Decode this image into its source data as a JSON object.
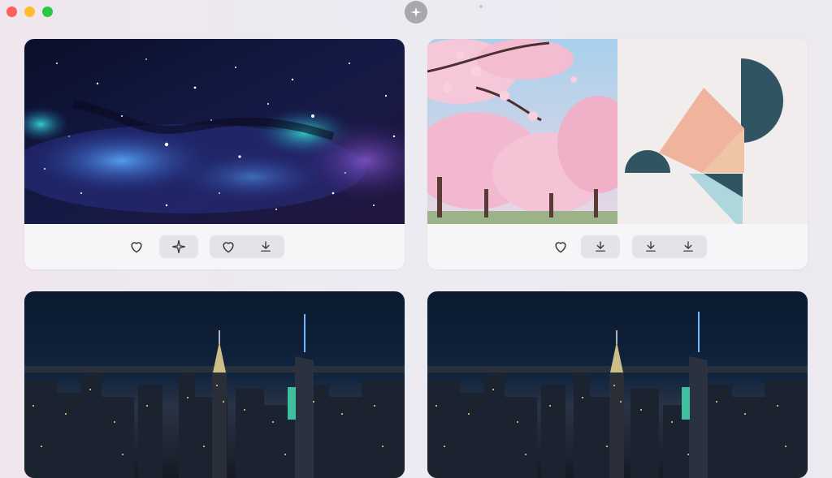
{
  "window": {
    "traffic_lights": [
      "close",
      "minimize",
      "zoom"
    ],
    "center_icon": "sparkle-icon",
    "secondary_icon": "small-sparkle-icon"
  },
  "colors": {
    "close": "#fe5f57",
    "minimize": "#febc2e",
    "zoom": "#28c840",
    "card_bg": "#f6f5f8",
    "button_bg": "#e4e3e7",
    "icon": "#3a3a3c"
  },
  "cards": [
    {
      "image": "galaxy-nebula",
      "actions": [
        "heart-icon",
        "sparkle-icon",
        "heart-icon",
        "download-icon"
      ]
    },
    {
      "image": "cherry-blossom-and-geometric-shapes",
      "actions": [
        "heart-icon",
        "download-icon",
        "download-icon",
        "download-icon"
      ]
    },
    {
      "image": "city-skyline-night"
    },
    {
      "image": "city-skyline-night"
    }
  ]
}
